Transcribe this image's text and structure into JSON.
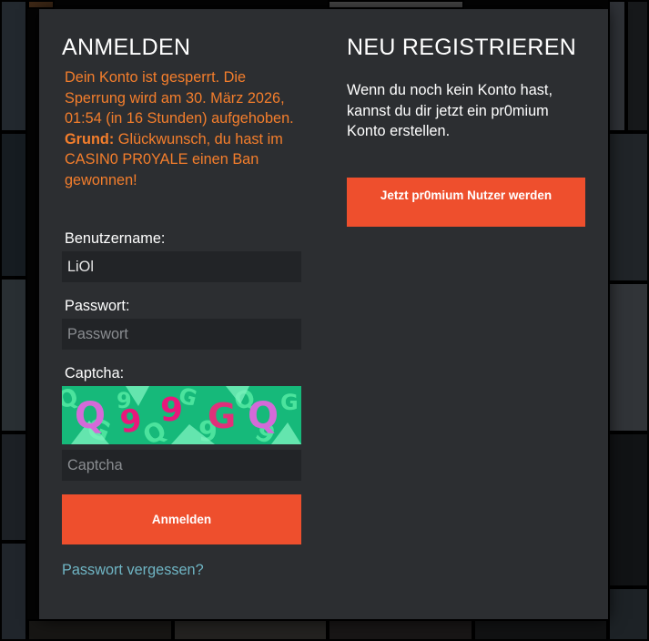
{
  "login": {
    "heading": "ANMELDEN",
    "ban_message": "Dein Konto ist gesperrt. Die Sperrung wird am 30. März 2026, 01:54 (in 16 Stunden) aufgehoben.",
    "ban_reason_label": "Grund:",
    "ban_reason": "Glückwunsch, du hast im CASIN0 PR0YALE einen Ban gewonnen!",
    "username_label": "Benutzername:",
    "username_value": "LiOl",
    "password_label": "Passwort:",
    "password_placeholder": "Passwort",
    "captcha_label": "Captcha:",
    "captcha_text": [
      "Q",
      "9",
      "9",
      "G",
      "Q"
    ],
    "captcha_placeholder": "Captcha",
    "submit_label": "Anmelden",
    "forgot_label": "Passwort vergessen?"
  },
  "register": {
    "heading": "NEU REGISTRIEREN",
    "description": "Wenn du noch kein Konto hast, kannst du dir jetzt ein pr0mium Konto erstellen.",
    "cta_label": "Jetzt pr0mium Nutzer werden"
  },
  "colors": {
    "modal_bg": "#2c2e31",
    "accent_button": "#ee4f2d",
    "ban_text": "#f47e2c",
    "link": "#6fb5c4",
    "field_bg": "#222427"
  }
}
